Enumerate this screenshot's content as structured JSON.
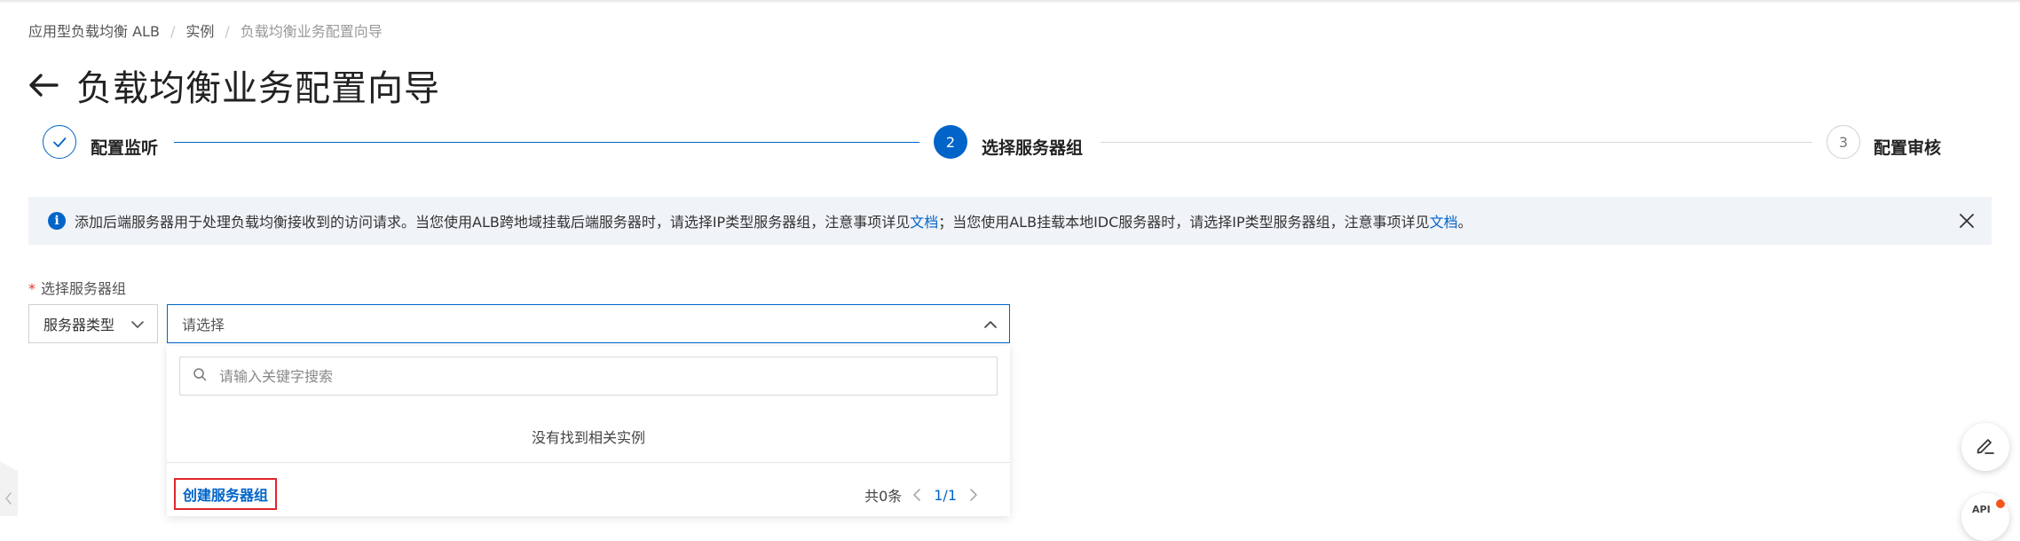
{
  "breadcrumb": {
    "items": [
      "应用型负载均衡 ALB",
      "实例",
      "负载均衡业务配置向导"
    ],
    "separator": "/"
  },
  "page": {
    "title": "负载均衡业务配置向导"
  },
  "steps": [
    {
      "label": "配置监听",
      "status": "done"
    },
    {
      "label": "选择服务器组",
      "number": "2",
      "status": "active"
    },
    {
      "label": "配置审核",
      "number": "3",
      "status": "todo"
    }
  ],
  "alert": {
    "text1": "添加后端服务器用于处理负载均衡接收到的访问请求。当您使用ALB跨地域挂载后端服务器时，请选择IP类型服务器组，注意事项详见",
    "link1": "文档",
    "text2": "；当您使用ALB挂载本地IDC服务器时，请选择IP类型服务器组，注意事项详见",
    "link2": "文档",
    "text3": "。"
  },
  "form": {
    "required_mark": "*",
    "label": "选择服务器组",
    "type_select": "服务器类型",
    "main_select_placeholder": "请选择"
  },
  "dropdown": {
    "search_placeholder": "请输入关键字搜索",
    "empty_text": "没有找到相关实例",
    "create_label": "创建服务器组",
    "total": "共0条",
    "page": "1/1"
  },
  "float_tools": {
    "other_label": "API"
  },
  "colors": {
    "primary": "#0064c8",
    "alert_bg": "#f0f3f8",
    "highlight_border": "#e0262c",
    "required": "#e0372c"
  },
  "icons": [
    "back-arrow-icon",
    "check-icon",
    "info-icon",
    "close-icon",
    "chevron-down-icon",
    "chevron-up-icon",
    "search-icon",
    "chevron-left-icon",
    "chevron-right-icon",
    "edit-icon"
  ]
}
